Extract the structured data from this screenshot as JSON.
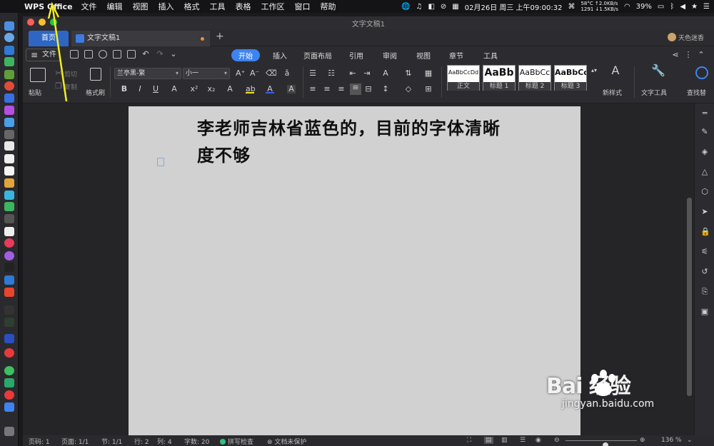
{
  "menubar": {
    "app_name": "WPS Office",
    "items": [
      "文件",
      "编辑",
      "视图",
      "插入",
      "格式",
      "工具",
      "表格",
      "工作区",
      "窗口",
      "帮助"
    ],
    "datetime": "02月26日 周三 上午09:00:32",
    "temp": "58°C",
    "fan": "1291",
    "net_up": "↑2.0KB/s",
    "net_down": "↓1.5KB/s",
    "battery": "39%"
  },
  "window": {
    "title": "文字文稿1",
    "tabs": {
      "home": "首页",
      "doc": "文字文稿1"
    },
    "user": "天色迷香"
  },
  "ribbon": {
    "file_label": "文件",
    "tabs": [
      "开始",
      "插入",
      "页面布局",
      "引用",
      "审阅",
      "视图",
      "章节",
      "工具"
    ],
    "active_tab": "开始"
  },
  "toolbar": {
    "paste": "粘贴",
    "cut": "剪切",
    "copy": "复制",
    "format_painter": "格式刷",
    "font_name": "兰亭黑-繁",
    "font_size": "小一",
    "styles": [
      {
        "sample": "AaBbCcDd",
        "name": "正文"
      },
      {
        "sample": "AaBb",
        "name": "标题 1"
      },
      {
        "sample": "AaBbCc",
        "name": "标题 2"
      },
      {
        "sample": "AaBbCc",
        "name": "标题 3"
      }
    ],
    "new_style": "新样式",
    "text_tools": "文字工具",
    "find_replace": "查找替"
  },
  "document": {
    "line1": "李老师吉林省蓝色的，目前的字体清晰",
    "line2": "度不够"
  },
  "status": {
    "page_no": "页码: 1",
    "pages": "页面: 1/1",
    "section": "节: 1/1",
    "row": "行: 2",
    "col": "列: 4",
    "word_count": "字数: 20",
    "spell_check": "拼写检查",
    "protect": "文档未保护",
    "zoom": "136 %",
    "zoom_value": 136
  },
  "watermark": {
    "logo": "Bai  经验",
    "site": "jingyan.baidu.com"
  },
  "colors": {
    "accent": "#3d84f0",
    "home_tab": "#2f66c4",
    "arrow": "#f3ee1a"
  }
}
